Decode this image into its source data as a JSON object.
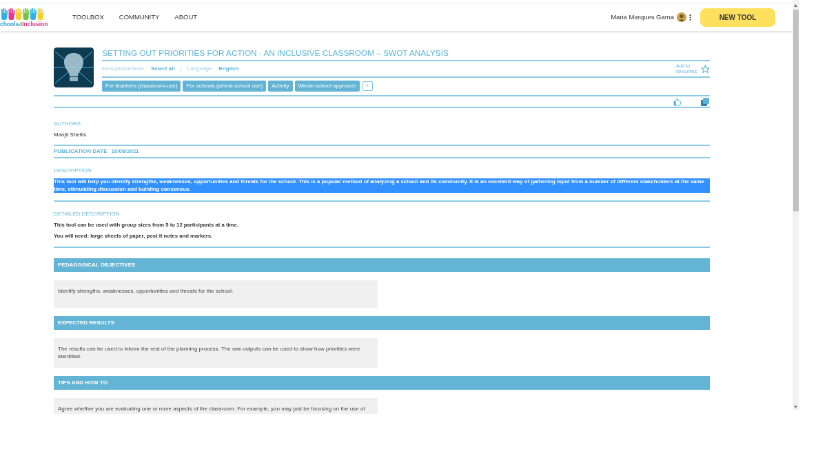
{
  "header": {
    "logo_text": [
      "chools",
      "4",
      "Inclusion"
    ],
    "nav": [
      {
        "label": "TOOLBOX"
      },
      {
        "label": "COMMUNITY"
      },
      {
        "label": "ABOUT"
      }
    ],
    "user_name": "Maria Marques Gama",
    "new_tool_button": "NEW TOOL"
  },
  "tool": {
    "title": "SETTING OUT PRIORITIES FOR ACTION - AN INCLUSIVE CLASSROOM – SWOT ANALYSIS",
    "educational_level_label": "Educational level :",
    "educational_level": "Select all",
    "separator": "|",
    "language_label": "Language:",
    "language": "English",
    "favourites_label": "Add to favourites",
    "favourited": false,
    "tags": [
      "For teachers (classroom-use)",
      "For schools (whole-school use)",
      "Activity",
      "Whole-school approach"
    ],
    "more_tags_button": "+",
    "liked": false
  },
  "authors": {
    "label": "AUTHORS",
    "value": "Manjit Shellis"
  },
  "publication": {
    "label": "PUBLICATION DATE",
    "value": "10/08/2021"
  },
  "description": {
    "label": "DESCRIPTION",
    "text": "This tool will help you identify strengths, weaknesses, opportunities and threats for the school. This is a popular method of analyzing a school and its community. It is an excellent way of gathering input from a number of different stakeholders at the same time, stimulating discussion and building consensus.",
    "selected": true
  },
  "detailed_description": {
    "label": "DETAILED DESCRIPTION",
    "lines": [
      "This tool can be used with group sizes from 5 to 12 participants at a time.",
      "You will need: large sheets of paper, post it notes and markers."
    ]
  },
  "sections": [
    {
      "heading": "PEDAGOGICAL OBJECTIVES",
      "text": "Identify strengths, weaknesses, opportunities and threats for the school."
    },
    {
      "heading": "EXPECTED RESULTS",
      "text": "The results can be used to inform the rest of the planning process. The raw outputs can be used to show how priorities were identified."
    },
    {
      "heading": "TIPS AND HOW TO",
      "text": "Agree whether you are evaluating one or more aspects of the classroom. For example, you may just be focusing on the use of"
    }
  ]
}
